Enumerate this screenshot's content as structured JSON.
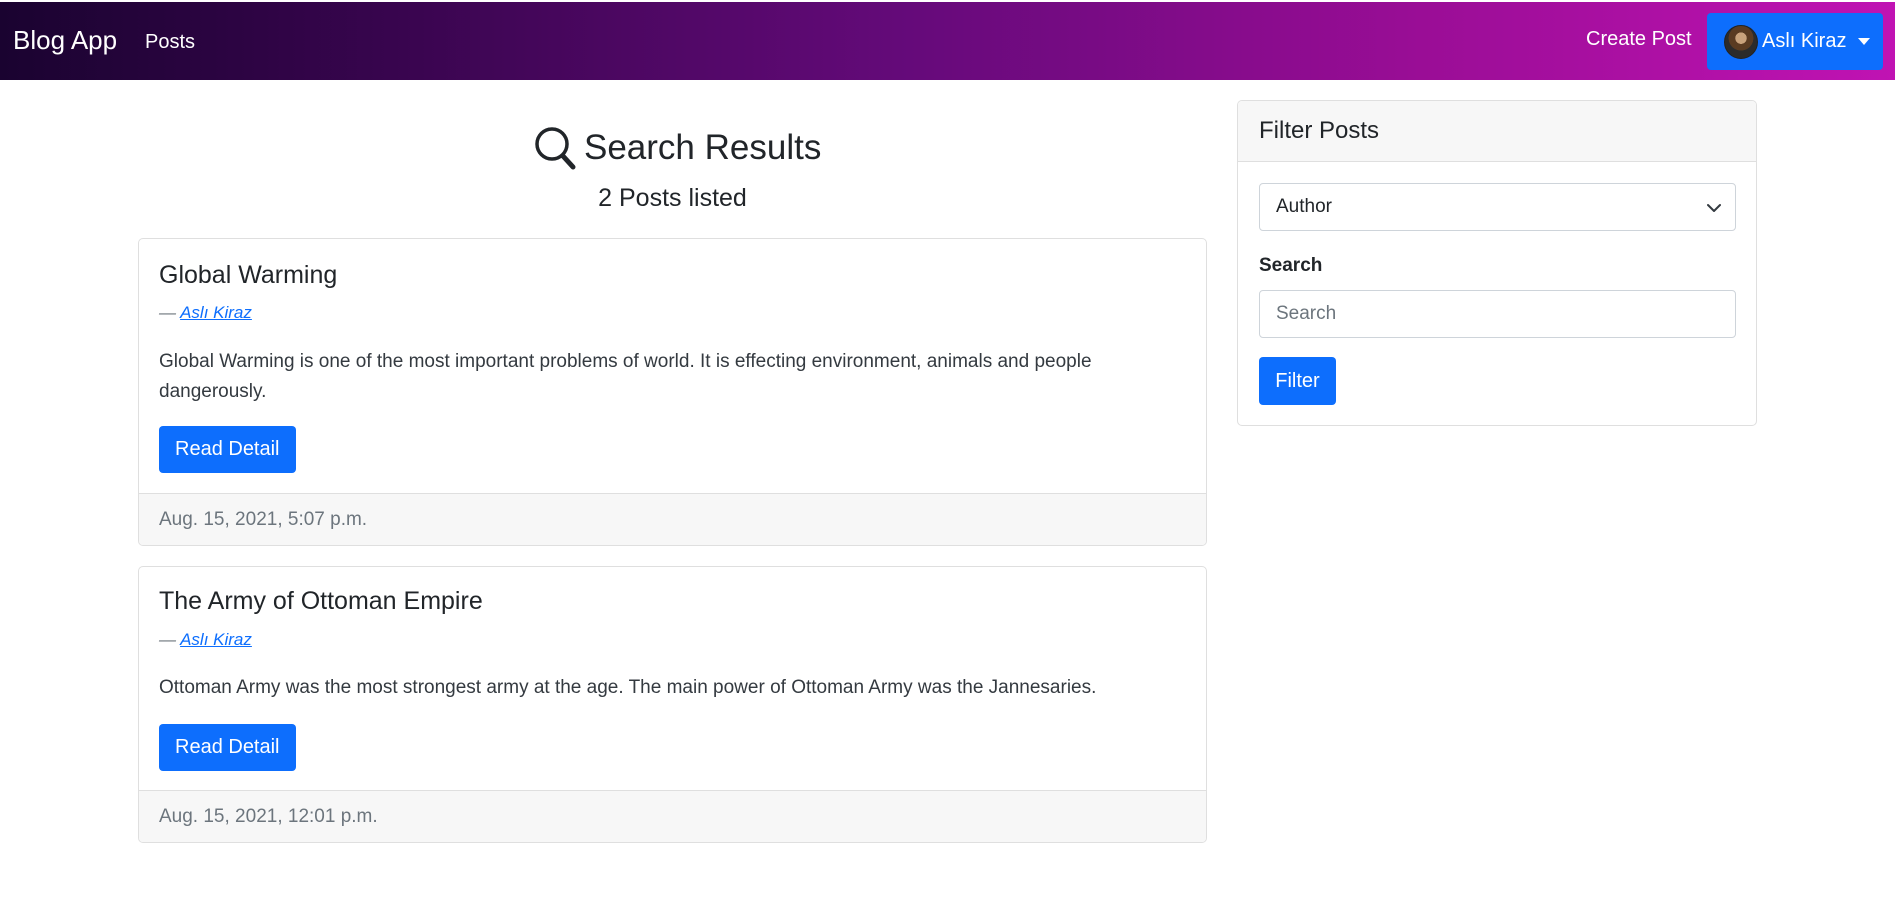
{
  "navbar": {
    "brand": "Blog App",
    "posts_link": "Posts",
    "create_post_link": "Create Post",
    "user": {
      "name": "Aslı Kiraz",
      "avatar_icon": "user-avatar"
    },
    "gradient_colors": [
      "#1a0330",
      "#c013b3"
    ]
  },
  "results": {
    "title": "Search Results",
    "count_text": "2 Posts listed",
    "icon": "search-icon"
  },
  "posts": [
    {
      "title": "Global Warming",
      "author_prefix": "—",
      "author": "Aslı Kiraz",
      "excerpt": "Global Warming is one of the most important problems of world. It is effecting environment, animals and people dangerously.",
      "button_label": "Read Detail",
      "date": "Aug. 15, 2021, 5:07 p.m."
    },
    {
      "title": "The Army of Ottoman Empire",
      "author_prefix": "—",
      "author": "Aslı Kiraz",
      "excerpt": "Ottoman Army was the most strongest army at the age. The main power of Ottoman Army was the Jannesaries.",
      "button_label": "Read Detail",
      "date": "Aug. 15, 2021, 12:01 p.m."
    }
  ],
  "filter": {
    "header": "Filter Posts",
    "author_select_value": "Author",
    "search_label": "Search",
    "search_placeholder": "Search",
    "search_value": "",
    "button_label": "Filter"
  },
  "colors": {
    "primary": "#0d6efd",
    "text": "#212529",
    "muted": "#6c757d"
  }
}
